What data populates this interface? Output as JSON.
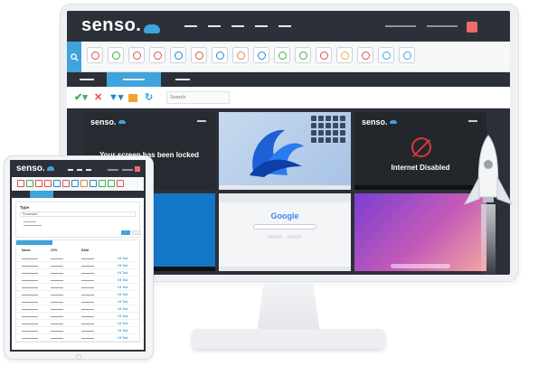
{
  "app": {
    "brand": "senso.",
    "accent": "#3fa3dc",
    "alert": "#f06a6a",
    "chrome": "#2c3139"
  },
  "toolbar_icons": [
    {
      "name": "block-icon",
      "color": "#e24b4b"
    },
    {
      "name": "document-icon",
      "color": "#3fae49"
    },
    {
      "name": "no-internet-icon",
      "color": "#e24b4b"
    },
    {
      "name": "globe-icon",
      "color": "#e24b4b"
    },
    {
      "name": "image-icon",
      "color": "#1e88c8"
    },
    {
      "name": "close-window-icon",
      "color": "#e24b4b"
    },
    {
      "name": "login-icon",
      "color": "#1e88c8"
    },
    {
      "name": "send-icon",
      "color": "#e2873a"
    },
    {
      "name": "file-icon",
      "color": "#1e88c8"
    },
    {
      "name": "settings-icon",
      "color": "#3fae49"
    },
    {
      "name": "rocket-icon",
      "color": "#3fae49"
    },
    {
      "name": "usb-icon",
      "color": "#e24b4b"
    },
    {
      "name": "note-icon",
      "color": "#e2b93a"
    },
    {
      "name": "warning-icon",
      "color": "#e24b4b"
    },
    {
      "name": "shield-icon",
      "color": "#3fa3dc"
    },
    {
      "name": "screenshot-icon",
      "color": "#3fa3dc"
    }
  ],
  "actions": {
    "search_placeholder": "Search"
  },
  "tiles": {
    "locked_message": "Your screen has been locked",
    "internet_message": "Internet Disabled",
    "google_logo": "Google",
    "tile_brand": "senso."
  },
  "tablet": {
    "brand": "senso.",
    "form_label": "Type",
    "form_select": "Processes",
    "columns": [
      "Name",
      "CPU",
      "RAM"
    ],
    "row_action": "Kill Task",
    "row_count": 12
  }
}
